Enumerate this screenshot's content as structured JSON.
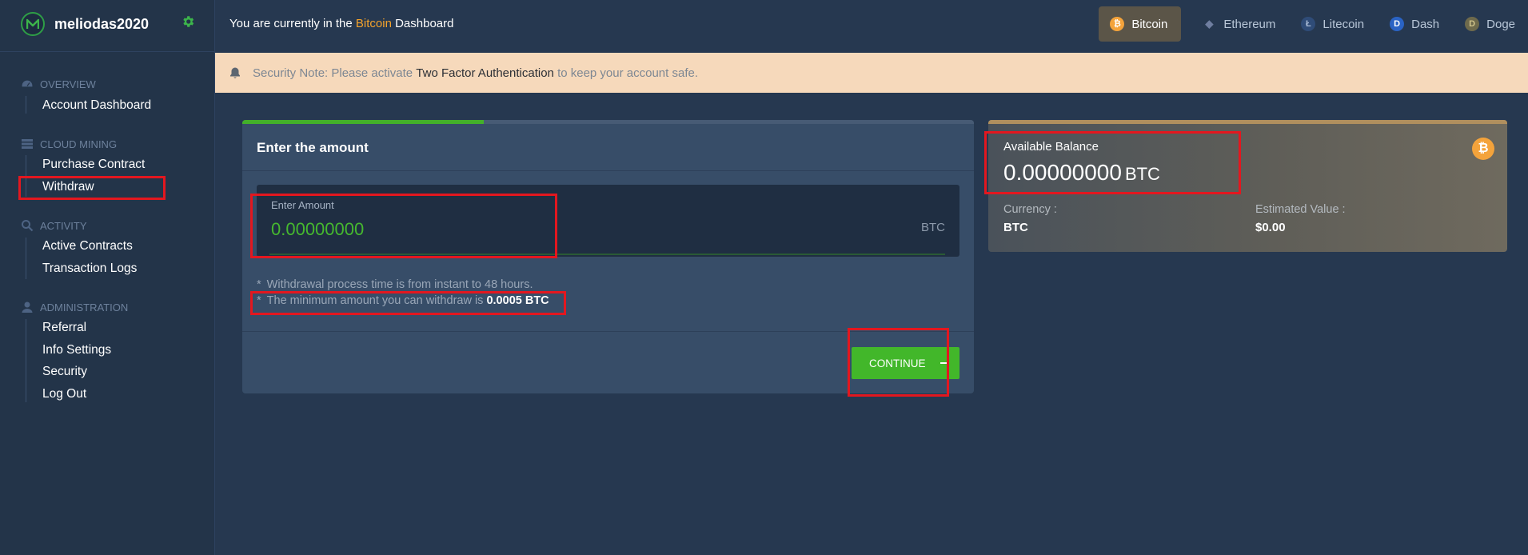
{
  "app": {
    "username": "meliodas2020"
  },
  "topbar": {
    "prefix": "You are currently in the",
    "coin": "Bitcoin",
    "suffix": "Dashboard"
  },
  "coins": [
    {
      "label": "Bitcoin",
      "icon": "bitcoin-icon",
      "symbol": "₿",
      "color": "#f4a33b",
      "active": true
    },
    {
      "label": "Ethereum",
      "icon": "ethereum-icon",
      "symbol": "◆",
      "color": "#6f7ea0",
      "active": false
    },
    {
      "label": "Litecoin",
      "icon": "litecoin-icon",
      "symbol": "Ł",
      "color": "#3b5a8c",
      "active": false
    },
    {
      "label": "Dash",
      "icon": "dash-icon",
      "symbol": "D",
      "color": "#2a63c4",
      "active": false
    },
    {
      "label": "Doge",
      "icon": "doge-icon",
      "symbol": "D",
      "color": "#8c7a3f",
      "active": false
    }
  ],
  "banner": {
    "prefix": "Security Note: Please activate",
    "link": "Two Factor Authentication",
    "suffix": "to keep your account safe."
  },
  "sidebar": {
    "sections": [
      {
        "title": "Overview",
        "icon": "dashboard-gauge-icon",
        "items": [
          "Account Dashboard"
        ]
      },
      {
        "title": "Cloud Mining",
        "icon": "server-stack-icon",
        "items": [
          "Purchase Contract",
          "Withdraw"
        ]
      },
      {
        "title": "Activity",
        "icon": "search-icon",
        "items": [
          "Active Contracts",
          "Transaction Logs"
        ]
      },
      {
        "title": "Administration",
        "icon": "user-icon",
        "items": [
          "Referral",
          "Info Settings",
          "Security",
          "Log Out"
        ]
      }
    ]
  },
  "withdraw": {
    "title": "Enter the amount",
    "progress": 0.33,
    "amount_label": "Enter Amount",
    "amount_value": "0.00000000",
    "amount_unit": "BTC",
    "note1": "Withdrawal process time is from instant to 48 hours.",
    "note2_prefix": "The minimum amount you can withdraw is",
    "note2_value": "0.0005 BTC",
    "continue_label": "Continue"
  },
  "balance": {
    "label": "Available Balance",
    "value": "0.00000000",
    "unit": "BTC",
    "currency_label": "Currency :",
    "currency_value": "BTC",
    "estimated_label": "Estimated Value :",
    "estimated_value": "$0.00"
  },
  "colors": {
    "accent_green": "#42b72a",
    "bitcoin_orange": "#f4a33b",
    "highlight_red": "#e3171f"
  }
}
